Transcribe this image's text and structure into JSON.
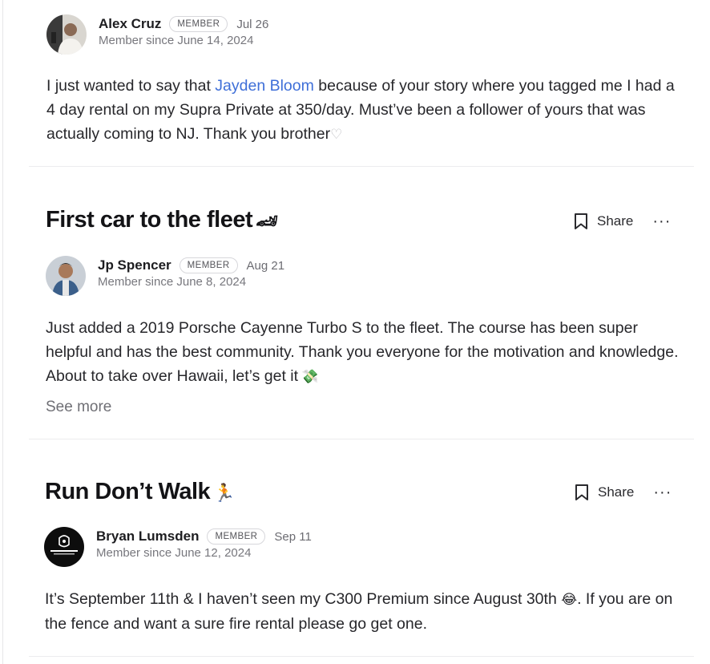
{
  "posts": [
    {
      "author": {
        "name": "Alex Cruz",
        "badge": "MEMBER",
        "date": "Jul 26",
        "since": "Member since June 14, 2024"
      },
      "body": {
        "before": "I just wanted to say that ",
        "mention": "Jayden Bloom",
        "after": " because of your story where you tagged me I had a 4 day rental on my Supra Private at 350/day. Must’ve been a follower of yours that was actually coming to NJ. Thank you brother",
        "emoji": "♡"
      }
    },
    {
      "title": "First car to the fleet",
      "title_emoji": "🏎",
      "share_label": "Share",
      "more_label": "···",
      "author": {
        "name": "Jp Spencer",
        "badge": "MEMBER",
        "date": "Aug 21",
        "since": "Member since June 8, 2024"
      },
      "body": {
        "text": "Just added a 2019 Porsche Cayenne Turbo S to the fleet. The course has been super helpful and has the best community. Thank you everyone for the motivation and knowledge. About to take over Hawaii, let’s get it",
        "emoji": "💸"
      },
      "see_more": "See more"
    },
    {
      "title": "Run Don’t Walk",
      "title_emoji": "🏃",
      "share_label": "Share",
      "more_label": "···",
      "author": {
        "name": "Bryan Lumsden",
        "badge": "MEMBER",
        "date": "Sep 11",
        "since": "Member since June 12, 2024"
      },
      "body": {
        "before": "It’s September 11th & I haven’t seen my C300 Premium since August 30th ",
        "emoji": "😂",
        "after": ". If you are on the fence and want a sure fire rental please go get one."
      }
    }
  ],
  "icons": {
    "bookmark": "bookmark-icon",
    "more": "more-horizontal-icon"
  },
  "colors": {
    "mention": "#3f6fd8",
    "text": "#27272b",
    "muted": "#6f6f75"
  }
}
